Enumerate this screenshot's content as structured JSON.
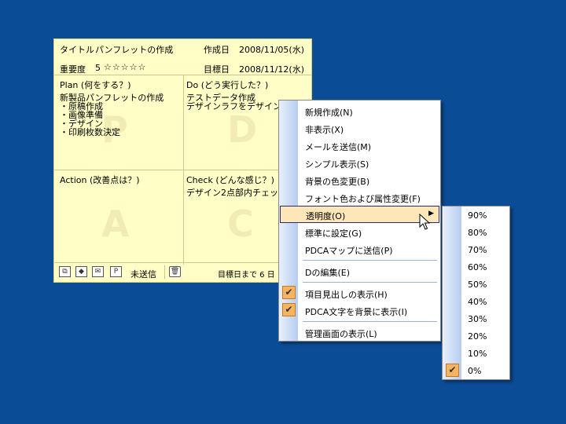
{
  "note": {
    "title_label": "タイトル",
    "title_value": "パンフレットの作成",
    "created_label": "作成日",
    "created_value": "2008/11/05(水)",
    "importance_label": "重要度",
    "importance_value": "5",
    "importance_stars": "☆☆☆☆☆",
    "target_label": "目標日",
    "target_value": "2008/11/12(水)",
    "plan": {
      "title": "Plan (何をする？)",
      "body": "新製品パンフレットの作成\n・原稿作成\n・画像準備\n・デザイン\n・印刷枚数決定",
      "letter": "P"
    },
    "do": {
      "title": "Do (どう実行した？)",
      "body": "テストデータ作成\nデザインラフをデザイン会社",
      "letter": "D"
    },
    "action": {
      "title": "Action (改善点は？)",
      "body": "",
      "letter": "A"
    },
    "check": {
      "title": "Check (どんな感じ？)",
      "body": "デザイン2点部内チェック",
      "letter": "C"
    },
    "status": {
      "send_state": "未送信",
      "days_left": "目標日まで 6 日"
    }
  },
  "menu": {
    "items": [
      {
        "label": "新規作成(N)",
        "checked": false
      },
      {
        "label": "非表示(X)",
        "checked": false
      },
      {
        "label": "メールを送信(M)",
        "checked": false
      },
      {
        "label": "シンプル表示(S)",
        "checked": false
      },
      {
        "label": "背景の色変更(B)",
        "checked": false
      },
      {
        "label": "フォント色および属性変更(F)",
        "checked": false
      },
      {
        "label": "透明度(O)",
        "checked": false,
        "submenu": true
      },
      {
        "label": "標準に設定(G)",
        "checked": false
      },
      {
        "label": "PDCAマップに送信(P)",
        "checked": false
      },
      {
        "label": "Dの編集(E)",
        "checked": false
      },
      {
        "label": "項目見出しの表示(H)",
        "checked": true
      },
      {
        "label": "PDCA文字を背景に表示(I)",
        "checked": true
      },
      {
        "label": "管理画面の表示(L)",
        "checked": false
      }
    ]
  },
  "transparency": {
    "options": [
      "90%",
      "80%",
      "70%",
      "60%",
      "50%",
      "40%",
      "30%",
      "20%",
      "10%",
      "0%"
    ],
    "selected": "0%"
  },
  "colors": {
    "desktop": "#0b4c97",
    "note": "#fefec6",
    "highlight": "#fde7b9",
    "check": "#f6b360"
  }
}
